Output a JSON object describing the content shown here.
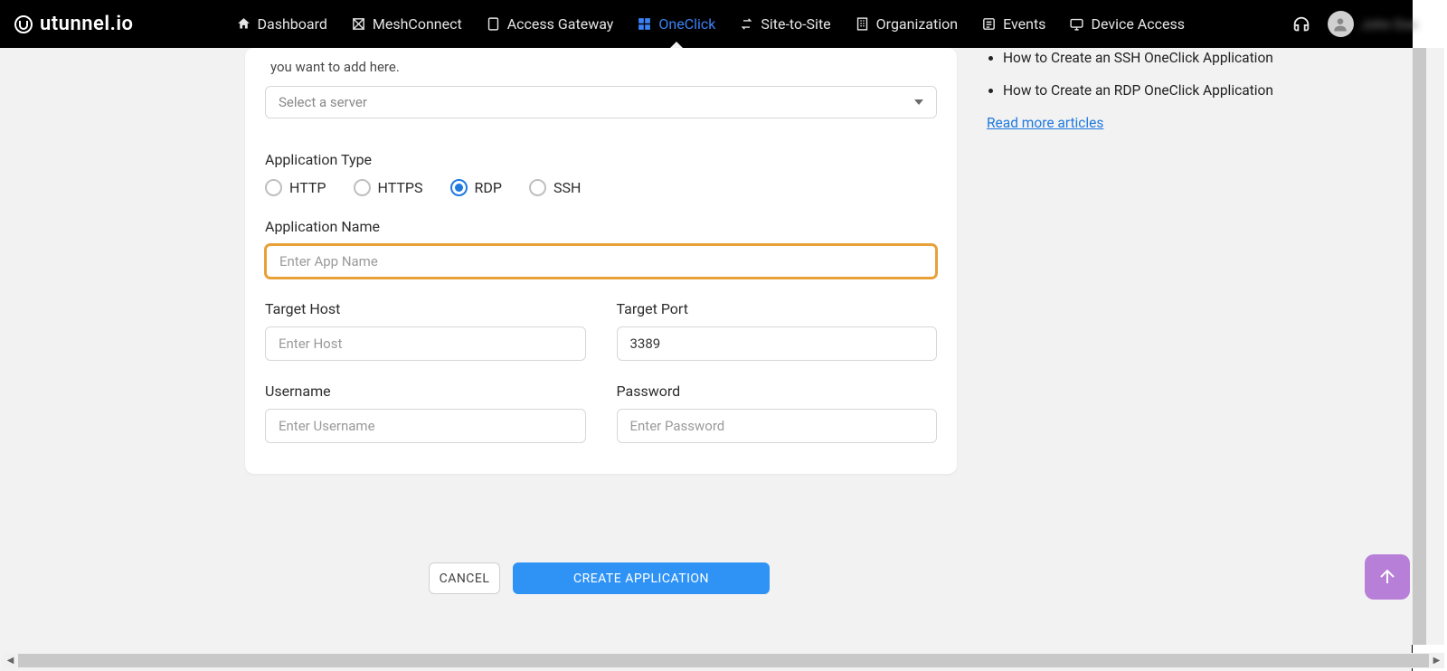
{
  "brand": "utunnel.io",
  "nav": {
    "dashboard": "Dashboard",
    "meshconnect": "MeshConnect",
    "accessgateway": "Access Gateway",
    "oneclick": "OneClick",
    "sitetosite": "Site-to-Site",
    "organization": "Organization",
    "events": "Events",
    "deviceaccess": "Device Access"
  },
  "user": {
    "name": "John Doe"
  },
  "form": {
    "info_text": "you want to add here.",
    "server_placeholder": "Select a server",
    "app_type_label": "Application Type",
    "type_http": "HTTP",
    "type_https": "HTTPS",
    "type_rdp": "RDP",
    "type_ssh": "SSH",
    "app_name_label": "Application Name",
    "app_name_placeholder": "Enter App Name",
    "target_host_label": "Target Host",
    "target_host_placeholder": "Enter Host",
    "target_port_label": "Target Port",
    "target_port_value": "3389",
    "username_label": "Username",
    "username_placeholder": "Enter Username",
    "password_label": "Password",
    "password_placeholder": "Enter Password"
  },
  "help": {
    "item1": "How to Create an SSH OneClick Application",
    "item2": "How to Create an RDP OneClick Application",
    "more": "Read more articles"
  },
  "buttons": {
    "cancel": "CANCEL",
    "create": "CREATE APPLICATION"
  }
}
